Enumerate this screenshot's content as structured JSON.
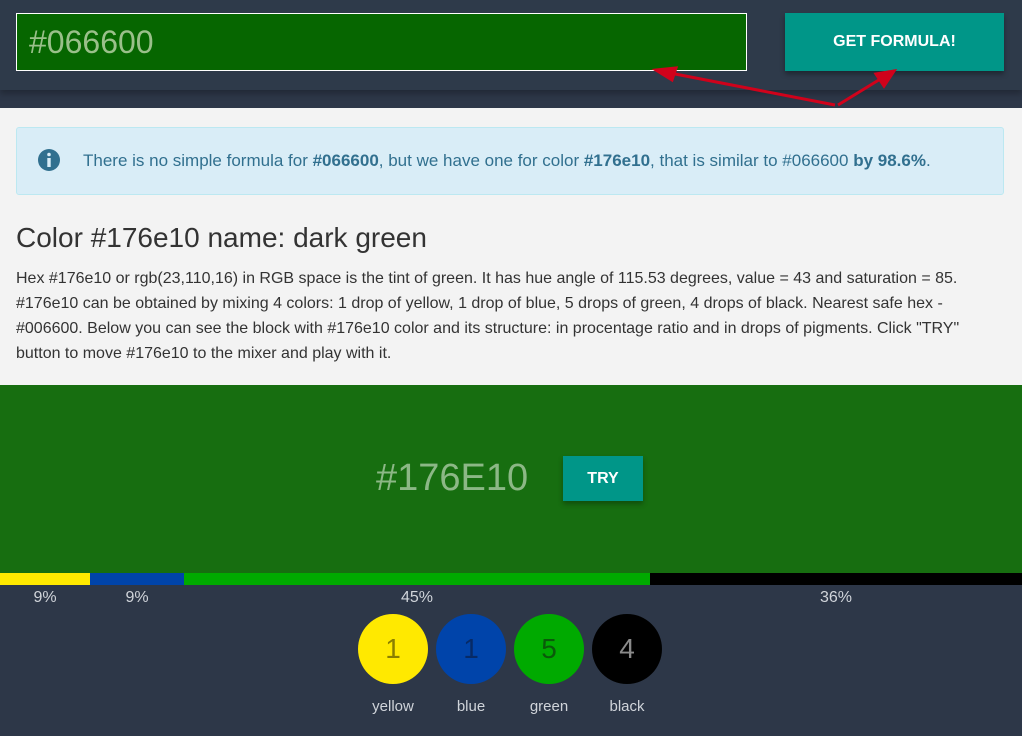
{
  "header": {
    "hex_value": "#066600",
    "formula_button": "GET FORMULA!"
  },
  "info": {
    "icon": "info-circle-icon",
    "prefix": "There is no simple formula for ",
    "query_hex": "#066600",
    "middle": ", but we have one for color ",
    "found_hex": "#176e10",
    "middle2": ", that is similar to #066600 ",
    "similarity": "by 98.6%",
    "suffix": "."
  },
  "color": {
    "title": "Color #176e10 name: dark green",
    "description": "Hex #176e10 or rgb(23,110,16) in RGB space is the tint of green. It has hue angle of 115.53 degrees, value = 43 and saturation = 85. #176e10 can be obtained by mixing 4 colors: 1 drop of yellow, 1 drop of blue, 5 drops of green, 4 drops of black. Nearest safe hex - #006600. Below you can see the block with #176e10 color and its structure: in procentage ratio and in drops of pigments. Click \"TRY\" button to move #176e10 to the mixer and play with it.",
    "swatch_hex": "#176E10",
    "swatch_color": "#176e10",
    "try_button": "TRY"
  },
  "pigments": [
    {
      "name": "yellow",
      "drops": "1",
      "percent": "9%",
      "share": 0.0882,
      "color": "#ffe900",
      "text_color": "#8a7f00"
    },
    {
      "name": "blue",
      "drops": "1",
      "percent": "9%",
      "share": 0.092,
      "color": "#0044aa",
      "text_color": "#072a66"
    },
    {
      "name": "green",
      "drops": "5",
      "percent": "45%",
      "share": 0.456,
      "color": "#00aa00",
      "text_color": "#0a5a0a"
    },
    {
      "name": "black",
      "drops": "4",
      "percent": "36%",
      "share": 0.3638,
      "color": "#000000",
      "text_color": "#8a8a8a"
    }
  ],
  "colors": {
    "accent": "#009688",
    "input_bg": "#066600",
    "info_bg": "#d9edf7",
    "info_text": "#31708f",
    "annotation_arrow": "#d0021b"
  }
}
